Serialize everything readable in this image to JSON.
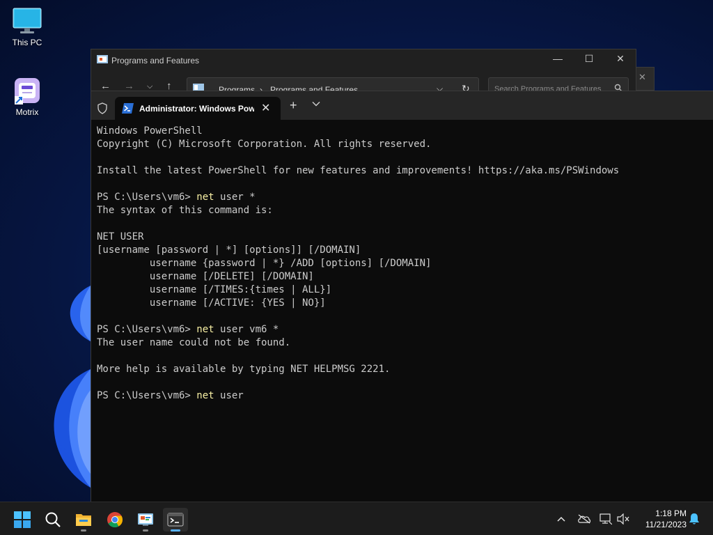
{
  "desktop": {
    "icons": [
      {
        "label": "This PC",
        "icon": "monitor-icon"
      },
      {
        "label": "Motrix",
        "icon": "motrix-app-icon"
      }
    ]
  },
  "programs_window": {
    "title": "Programs and Features",
    "breadcrumb": [
      "Programs",
      "Programs and Features"
    ],
    "search_placeholder": "Search Programs and Features"
  },
  "terminal": {
    "tab_title": "Administrator: Windows PowerShell",
    "prompt": "PS C:\\Users\\vm6> ",
    "lines": [
      {
        "text": "Windows PowerShell"
      },
      {
        "text": "Copyright (C) Microsoft Corporation. All rights reserved."
      },
      {
        "text": ""
      },
      {
        "text": "Install the latest PowerShell for new features and improvements! https://aka.ms/PSWindows"
      },
      {
        "text": ""
      },
      {
        "prompt": "PS C:\\Users\\vm6> ",
        "cmd": "net",
        "args": " user *"
      },
      {
        "text": "The syntax of this command is:"
      },
      {
        "text": ""
      },
      {
        "text": "NET USER"
      },
      {
        "text": "[username [password | *] [options]] [/DOMAIN]"
      },
      {
        "text": "         username {password | *} /ADD [options] [/DOMAIN]"
      },
      {
        "text": "         username [/DELETE] [/DOMAIN]"
      },
      {
        "text": "         username [/TIMES:{times | ALL}]"
      },
      {
        "text": "         username [/ACTIVE: {YES | NO}]"
      },
      {
        "text": ""
      },
      {
        "prompt": "PS C:\\Users\\vm6> ",
        "cmd": "net",
        "args": " user vm6 *"
      },
      {
        "text": "The user name could not be found."
      },
      {
        "text": ""
      },
      {
        "text": "More help is available by typing NET HELPMSG 2221."
      },
      {
        "text": ""
      },
      {
        "prompt": "PS C:\\Users\\vm6> ",
        "cmd": "net",
        "args": " user"
      }
    ]
  },
  "taskbar": {
    "apps": [
      {
        "name": "start",
        "icon": "windows-logo-icon"
      },
      {
        "name": "search",
        "icon": "search-icon"
      },
      {
        "name": "file-explorer",
        "icon": "folder-icon"
      },
      {
        "name": "chrome",
        "icon": "chrome-icon"
      },
      {
        "name": "control-panel",
        "icon": "control-panel-icon"
      },
      {
        "name": "terminal",
        "icon": "terminal-icon",
        "active": true
      }
    ],
    "time": "1:18 PM",
    "date": "11/21/2023"
  },
  "colors": {
    "terminal_bg": "#0c0c0c",
    "terminal_text": "#cccccc",
    "command_highlight": "#f9f1a5",
    "accent": "#5ab3ff"
  }
}
